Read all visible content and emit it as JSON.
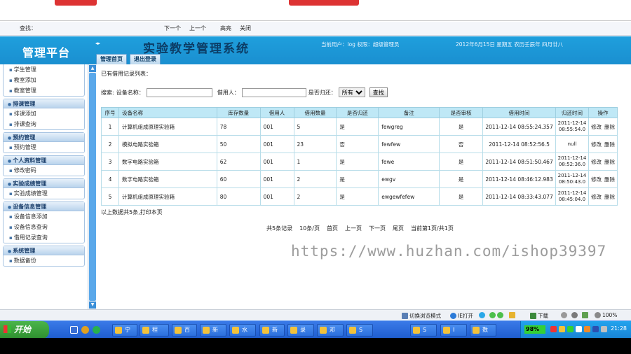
{
  "find_bar": {
    "label": "查找：",
    "next": "下一个",
    "prev": "上一个",
    "highlight": "高亮",
    "close": "关闭"
  },
  "header": {
    "logo": "管理平台",
    "collapse": "◂▸",
    "title": "实验教学管理系统",
    "user_info": "当前用户：log 权限：超级管理员",
    "date_info": "2012年6月15日 星期五 农历壬辰年 四月廿八",
    "tabs": [
      "管理首页",
      "退出登录"
    ]
  },
  "sidebar": {
    "groups": [
      {
        "title": "",
        "items": [
          "学生管理",
          "教室添加",
          "教室管理"
        ]
      },
      {
        "title": "排课管理",
        "items": [
          "排课添加",
          "排课查询"
        ]
      },
      {
        "title": "预约管理",
        "items": [
          "预约管理"
        ]
      },
      {
        "title": "个人资料管理",
        "items": [
          "修改密码"
        ]
      },
      {
        "title": "实验成绩管理",
        "items": [
          "实验成绩管理"
        ]
      },
      {
        "title": "设备信息管理",
        "items": [
          "设备信息添加",
          "设备信息查询",
          "借用记录查询"
        ]
      },
      {
        "title": "系统管理",
        "items": [
          "数据备份"
        ]
      }
    ]
  },
  "main": {
    "list_title": "已有借用记录列表：",
    "search": {
      "label": "搜索:",
      "device_label": "设备名称：",
      "borrower_label": "借用人：",
      "returned_label": "是否归还：",
      "returned_value": "所有",
      "button": "查找"
    },
    "table": {
      "headers": [
        "序号",
        "设备名称",
        "库存数量",
        "借用人",
        "借用数量",
        "是否归还",
        "备注",
        "是否审核",
        "借用时间",
        "归还时间",
        "操作"
      ],
      "rows": [
        [
          "1",
          "计算机组成原理实验箱",
          "78",
          "001",
          "5",
          "是",
          "fewgreg",
          "是",
          "2011-12-14 08:55:24.357",
          "2011-12-14 08:55:54.0"
        ],
        [
          "2",
          "模拟电路实验箱",
          "50",
          "001",
          "23",
          "否",
          "fewfew",
          "否",
          "2011-12-14 08:52:56.5",
          "null"
        ],
        [
          "3",
          "数字电路实验箱",
          "62",
          "001",
          "1",
          "是",
          "fewe",
          "是",
          "2011-12-14 08:51:50.467",
          "2011-12-14 08:52:36.0"
        ],
        [
          "4",
          "数字电路实验箱",
          "60",
          "001",
          "2",
          "是",
          "ewgv",
          "是",
          "2011-12-14 08:46:12.983",
          "2011-12-14 08:50:43.0"
        ],
        [
          "5",
          "计算机组成原理实验箱",
          "80",
          "001",
          "2",
          "是",
          "ewgewfefew",
          "是",
          "2011-12-14 08:33:43.077",
          "2011-12-14 08:45:04.0"
        ]
      ],
      "op_edit": "修改",
      "op_delete": "删除"
    },
    "summary": "以上数据共5条,打印本页",
    "pager": [
      "共5条记录",
      "10条/页",
      "首页",
      "上一页",
      "下一页",
      "尾页",
      "当前第1页/共1页"
    ],
    "watermark": "https://www.huzhan.com/ishop39397"
  },
  "statusbar": {
    "mode": "切换浏览模式",
    "ie_open": "IE打开",
    "download": "下载",
    "zoom": "100%"
  },
  "taskbar": {
    "start": "开始",
    "tasks": [
      "宁",
      "程",
      "百",
      "新",
      "水",
      "新",
      "录",
      "邓",
      "S",
      "S",
      "I",
      "数"
    ],
    "battery": "98%",
    "clock": "21:28"
  },
  "colors": {
    "header_blue": "#1a8fd0",
    "table_header": "#bfe8f6",
    "taskbar_blue": "#2b6fdd",
    "start_green": "#2e8f2f"
  }
}
